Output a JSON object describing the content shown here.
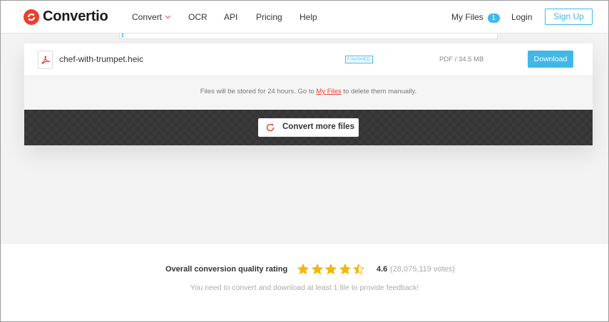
{
  "header": {
    "logo_text": "Convertio",
    "nav": [
      {
        "label": "Convert"
      },
      {
        "label": "OCR"
      },
      {
        "label": "API"
      },
      {
        "label": "Pricing"
      },
      {
        "label": "Help"
      }
    ],
    "my_files_label": "My Files",
    "my_files_count": "1",
    "login_label": "Login",
    "signup_label": "Sign Up"
  },
  "file": {
    "name": "chef-with-trumpet.heic",
    "status": "FINISHED",
    "meta": "PDF / 34.5 MB",
    "download_label": "Download"
  },
  "notice": {
    "before": "Files will be stored for 24 hours. Go to ",
    "link": "My Files",
    "after": " to delete them manually."
  },
  "convert_more_label": "Convert more files",
  "rating": {
    "label": "Overall conversion quality rating",
    "value": "4.6",
    "stars": 4.6,
    "votes": "(28,075,119 votes)",
    "feedback": "You need to convert and download at least 1 file to provide feedback!"
  },
  "colors": {
    "brand": "#e8412c",
    "accent": "#41b7e8",
    "star": "#f5b50a"
  }
}
